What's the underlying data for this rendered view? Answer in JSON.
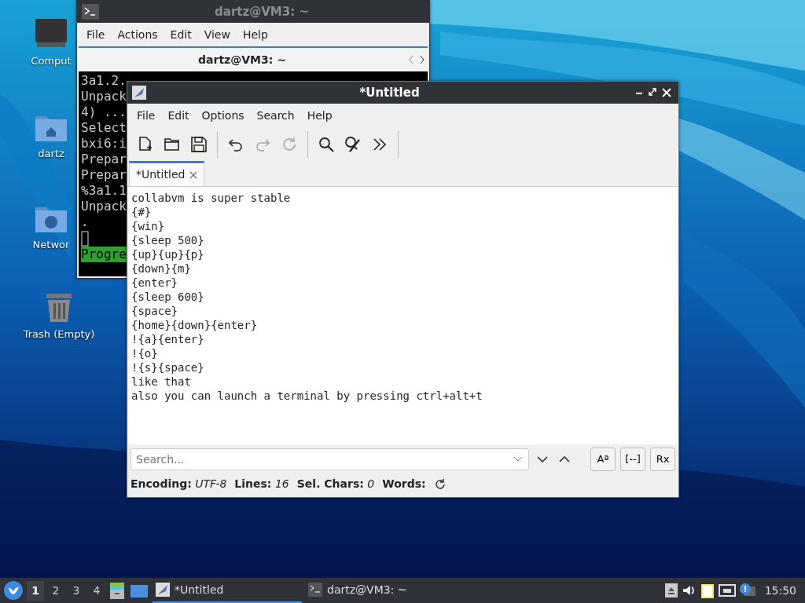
{
  "desktop_icons": [
    {
      "label": "Comput",
      "kind": "computer"
    },
    {
      "label": "dartz",
      "kind": "home"
    },
    {
      "label": "Networ",
      "kind": "network"
    },
    {
      "label": "Trash (Empty)",
      "kind": "trash"
    }
  ],
  "terminal": {
    "title": "dartz@VM3: ~",
    "menu": [
      "File",
      "Actions",
      "Edit",
      "View",
      "Help"
    ],
    "tab_title": "dartz@VM3: ~",
    "lines": [
      "3a1.2.",
      "Unpack",
      "4) ...",
      "Select",
      "bxi6:i",
      "Prepar",
      "Prepar",
      "%3a1.1",
      "Unpack",
      "."
    ],
    "progress_text": "Progre"
  },
  "editor": {
    "title": "*Untitled",
    "menu": [
      "File",
      "Edit",
      "Options",
      "Search",
      "Help"
    ],
    "toolbar": [
      {
        "kind": "new",
        "disabled": false
      },
      {
        "kind": "open",
        "disabled": false
      },
      {
        "kind": "save",
        "disabled": false
      },
      {
        "kind": "sep"
      },
      {
        "kind": "undo",
        "disabled": false
      },
      {
        "kind": "redo",
        "disabled": true
      },
      {
        "kind": "reload",
        "disabled": true
      },
      {
        "kind": "sep"
      },
      {
        "kind": "find",
        "disabled": false
      },
      {
        "kind": "replace",
        "disabled": false
      },
      {
        "kind": "more",
        "disabled": false
      },
      {
        "kind": "sep"
      }
    ],
    "tabs": [
      {
        "label": "*Untitled",
        "selected": true
      }
    ],
    "text_lines": [
      "collabvm is super stable",
      "{#}",
      "{win}",
      "{sleep 500}",
      "{up}{up}{p}",
      "{down}{m}",
      "{enter}",
      "{sleep 600}",
      "{space}",
      "{home}{down}{enter}",
      "!{a}{enter}",
      "!{o}",
      "!{s}{space}",
      "like that",
      "also you can launch a terminal by pressing ctrl+alt+t"
    ],
    "search": {
      "placeholder": "Search..."
    },
    "search_buttons": [
      {
        "label": "Aª"
      },
      {
        "label": "[--]"
      },
      {
        "label": "Rx"
      }
    ],
    "status": [
      {
        "label": "Encoding:",
        "value": "UTF-8"
      },
      {
        "label": "Lines:",
        "value": "16"
      },
      {
        "label": "Sel. Chars:",
        "value": "0"
      },
      {
        "label": "Words:"
      }
    ]
  },
  "taskbar": {
    "workspaces": [
      {
        "label": "1",
        "selected": true
      },
      {
        "label": "2",
        "selected": false
      },
      {
        "label": "3",
        "selected": false
      },
      {
        "label": "4",
        "selected": false
      }
    ],
    "tasks": [
      {
        "label": "*Untitled",
        "kind": "editor",
        "selected": true
      },
      {
        "label": "dartz@VM3: ~",
        "kind": "terminal",
        "selected": false
      }
    ],
    "clock": "15:50"
  }
}
